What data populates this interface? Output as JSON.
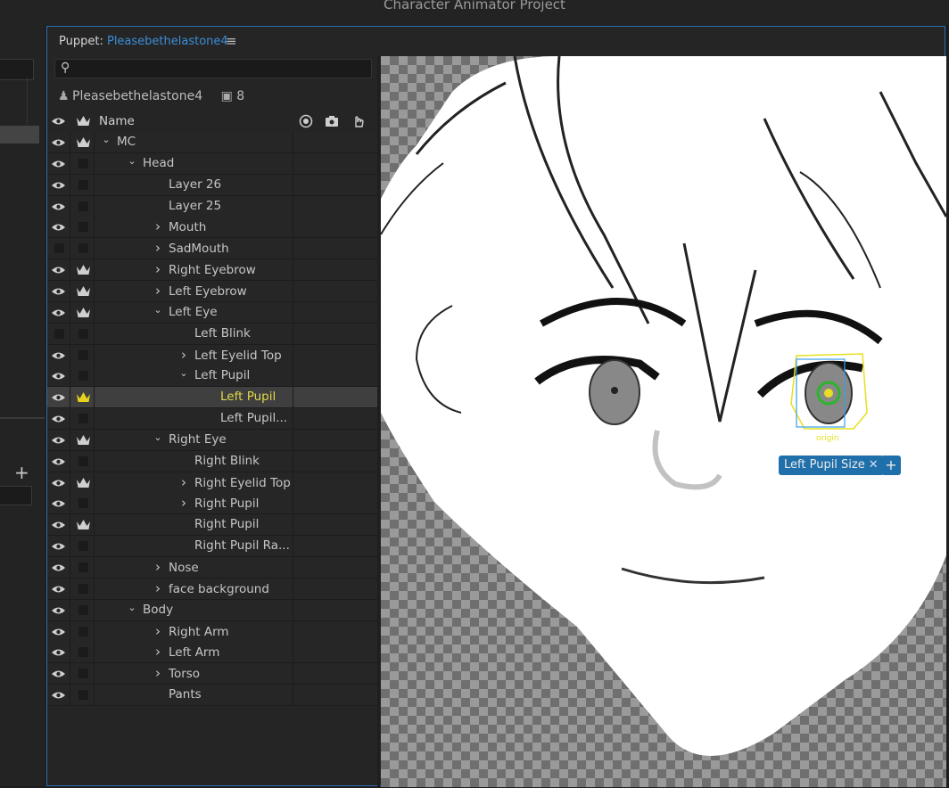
{
  "app": {
    "title": "Character Animator Project"
  },
  "panel": {
    "prefix": "Puppet:",
    "puppet_name": "Pleasebethelastone4",
    "menu_icon": "hamburger-icon"
  },
  "search": {
    "placeholder": "",
    "value": ""
  },
  "puppet_info": {
    "name": "Pleasebethelastone4",
    "camera_count": "8"
  },
  "tree": {
    "header_name": "Name",
    "rows": [
      {
        "label": "MC",
        "chevron": "down",
        "eye": true,
        "crown": true
      },
      {
        "label": "Head",
        "chevron": "down",
        "eye": true,
        "crown": false
      },
      {
        "label": "Layer 26",
        "chevron": "",
        "eye": true,
        "crown": false
      },
      {
        "label": "Layer 25",
        "chevron": "",
        "eye": true,
        "crown": false
      },
      {
        "label": "Mouth",
        "chevron": "right",
        "eye": true,
        "crown": false
      },
      {
        "label": "SadMouth",
        "chevron": "right",
        "eye": false,
        "crown": false
      },
      {
        "label": "Right Eyebrow",
        "chevron": "right",
        "eye": true,
        "crown": true
      },
      {
        "label": "Left Eyebrow",
        "chevron": "right",
        "eye": true,
        "crown": true
      },
      {
        "label": "Left Eye",
        "chevron": "down",
        "eye": true,
        "crown": true
      },
      {
        "label": "Left Blink",
        "chevron": "",
        "eye": false,
        "crown": false
      },
      {
        "label": "Left Eyelid Top",
        "chevron": "right",
        "eye": true,
        "crown": false
      },
      {
        "label": "Left Pupil",
        "chevron": "down",
        "eye": true,
        "crown": false
      },
      {
        "label": "Left Pupil",
        "chevron": "",
        "eye": true,
        "crown": true,
        "selected": true
      },
      {
        "label": "Left Pupil...",
        "chevron": "",
        "eye": true,
        "crown": false
      },
      {
        "label": "Right Eye",
        "chevron": "down",
        "eye": true,
        "crown": true
      },
      {
        "label": "Right Blink",
        "chevron": "",
        "eye": true,
        "crown": false
      },
      {
        "label": "Right Eyelid Top",
        "chevron": "right",
        "eye": true,
        "crown": true
      },
      {
        "label": "Right Pupil",
        "chevron": "right",
        "eye": true,
        "crown": false
      },
      {
        "label": "Right Pupil",
        "chevron": "",
        "eye": true,
        "crown": true
      },
      {
        "label": "Right Pupil Ra...",
        "chevron": "",
        "eye": true,
        "crown": false
      },
      {
        "label": "Nose",
        "chevron": "right",
        "eye": true,
        "crown": false
      },
      {
        "label": "face background",
        "chevron": "right",
        "eye": true,
        "crown": false
      },
      {
        "label": "Body",
        "chevron": "down",
        "eye": true,
        "crown": false
      },
      {
        "label": "Right Arm",
        "chevron": "right",
        "eye": true,
        "crown": false
      },
      {
        "label": "Left Arm",
        "chevron": "right",
        "eye": true,
        "crown": false
      },
      {
        "label": "Torso",
        "chevron": "right",
        "eye": true,
        "crown": false
      },
      {
        "label": "Pants",
        "chevron": "",
        "eye": true,
        "crown": false
      }
    ]
  },
  "viewport": {
    "tag_label": "Left Pupil Size",
    "origin_label": "origin",
    "selection_color": "#e6e020",
    "tag_color": "#1f6faa"
  },
  "left_panel": {
    "plus_label": "+"
  }
}
